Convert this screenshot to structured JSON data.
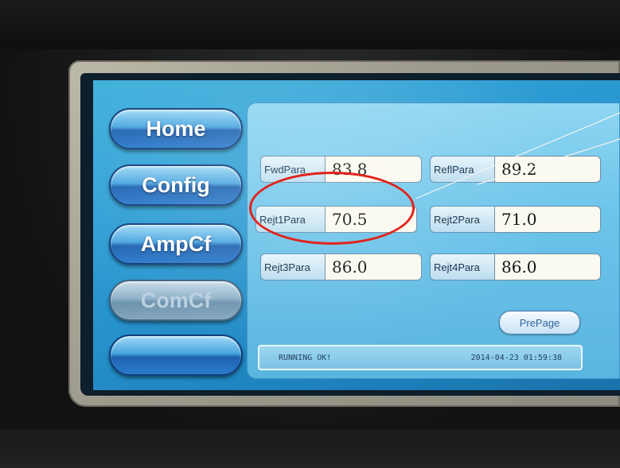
{
  "nav": {
    "items": [
      {
        "label": "Home",
        "enabled": true
      },
      {
        "label": "Config",
        "enabled": true
      },
      {
        "label": "AmpCf",
        "enabled": true
      },
      {
        "label": "ComCf",
        "enabled": false
      },
      {
        "label": "",
        "enabled": true
      }
    ]
  },
  "params": {
    "fwd": {
      "label": "FwdPara",
      "value": "83.8"
    },
    "refl": {
      "label": "ReflPara",
      "value": "89.2"
    },
    "rejt1": {
      "label": "Rejt1Para",
      "value": "70.5"
    },
    "rejt2": {
      "label": "Rejt2Para",
      "value": "71.0"
    },
    "rejt3": {
      "label": "Rejt3Para",
      "value": "86.0"
    },
    "rejt4": {
      "label": "Rejt4Para",
      "value": "86.0"
    }
  },
  "prepage_label": "PrePage",
  "status": {
    "message": "RUNNING OK!",
    "datetime": "2014-04-23 01:59:38"
  },
  "colors": {
    "highlight": "#e2231a",
    "screen": "#2c9bd3",
    "button": "#1f63b0"
  }
}
